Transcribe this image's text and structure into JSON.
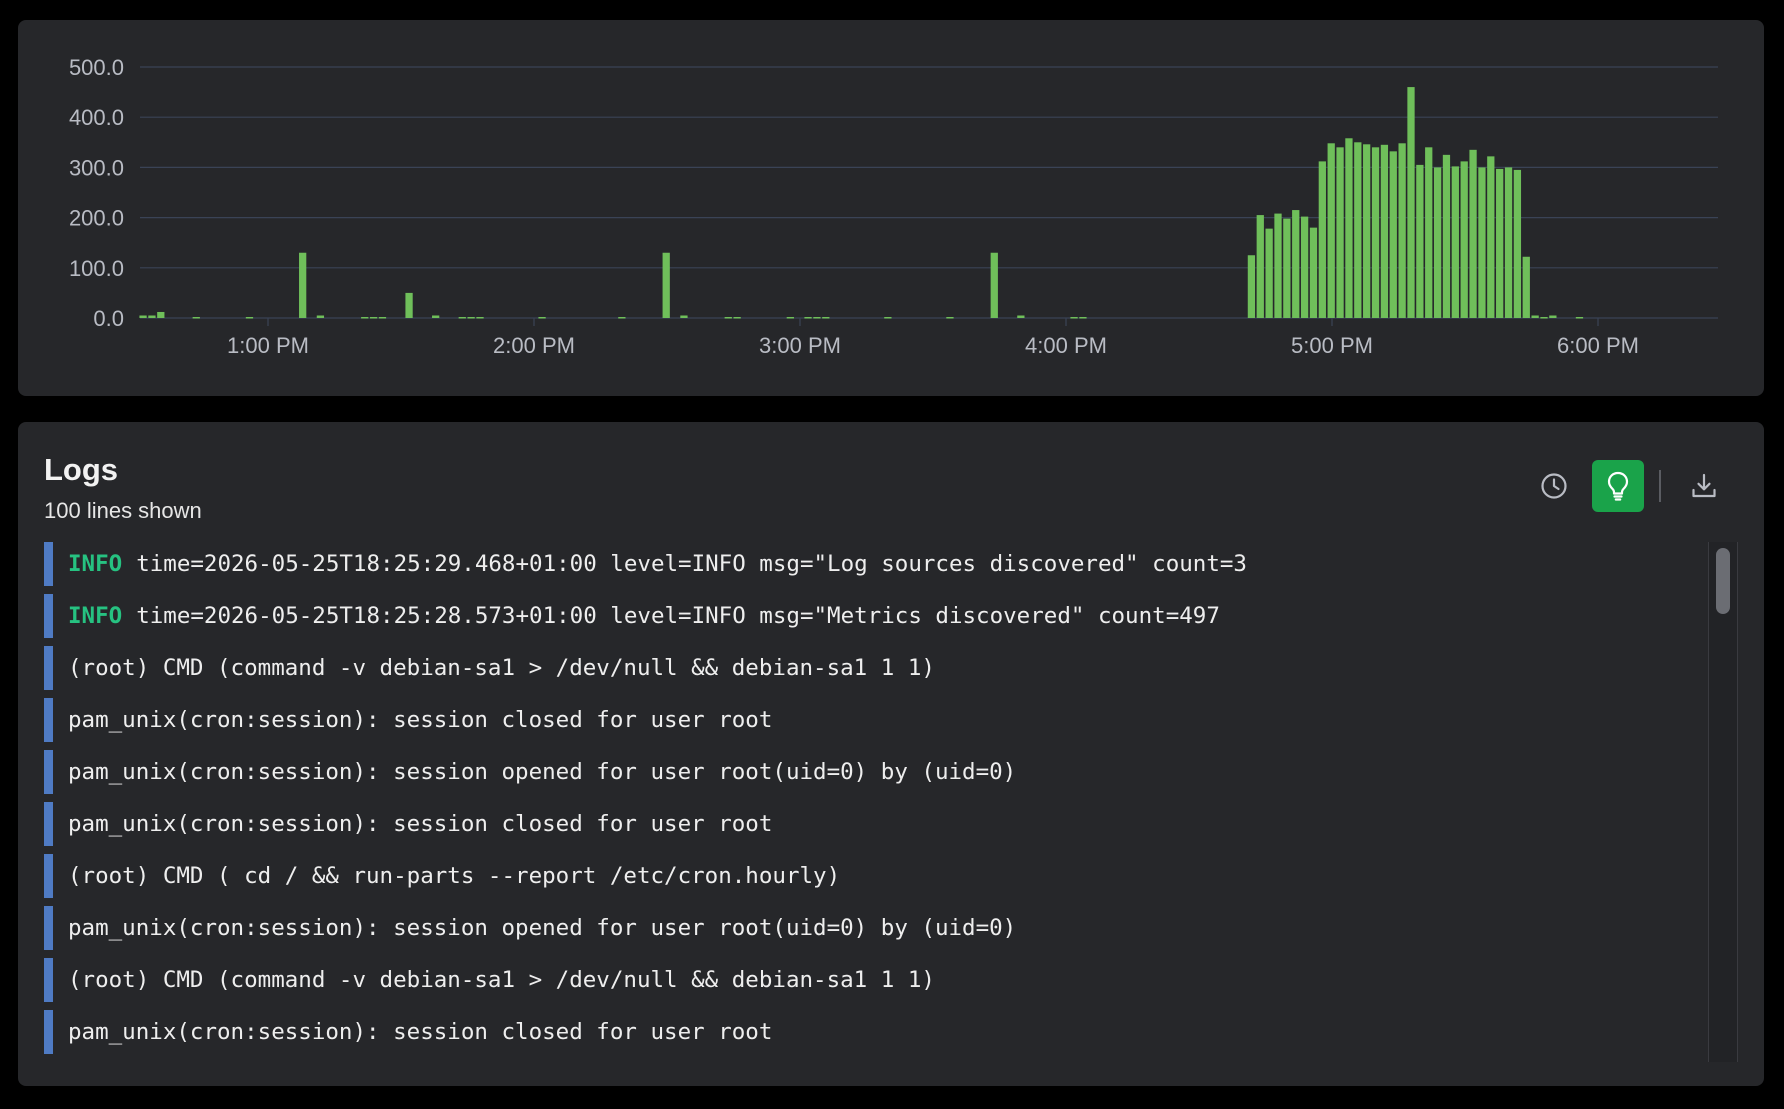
{
  "colors": {
    "bar": "#6fbf5a",
    "accent": "#1aa34a",
    "log_marker": "#4f7bc4",
    "level_info": "#26c281"
  },
  "chart_data": {
    "type": "bar",
    "title": "",
    "xlabel": "",
    "ylabel": "",
    "ylim": [
      0,
      500
    ],
    "y_ticks": [
      "500.0",
      "400.0",
      "300.0",
      "200.0",
      "100.0",
      "0.0"
    ],
    "x_ticks": [
      "1:00 PM",
      "2:00 PM",
      "3:00 PM",
      "4:00 PM",
      "5:00 PM",
      "6:00 PM"
    ],
    "grid": true,
    "x_start": "12:31 PM",
    "bin_minutes": 2,
    "values": [
      5,
      5,
      12,
      0,
      0,
      0,
      2,
      0,
      0,
      0,
      0,
      0,
      2,
      0,
      0,
      0,
      0,
      0,
      130,
      0,
      5,
      0,
      0,
      0,
      0,
      2,
      2,
      2,
      0,
      0,
      50,
      0,
      0,
      5,
      0,
      0,
      2,
      2,
      2,
      0,
      0,
      0,
      0,
      0,
      0,
      2,
      0,
      0,
      0,
      0,
      0,
      0,
      0,
      0,
      2,
      0,
      0,
      0,
      0,
      130,
      0,
      5,
      0,
      0,
      0,
      0,
      2,
      2,
      0,
      0,
      0,
      0,
      0,
      2,
      0,
      2,
      2,
      2,
      0,
      0,
      0,
      0,
      0,
      0,
      2,
      0,
      0,
      0,
      0,
      0,
      0,
      2,
      0,
      0,
      0,
      0,
      130,
      0,
      0,
      5,
      0,
      0,
      0,
      0,
      0,
      2,
      2,
      0,
      0,
      0,
      0,
      0,
      0,
      0,
      0,
      0,
      0,
      0,
      0,
      0,
      0,
      0,
      0,
      0,
      0,
      125,
      205,
      178,
      208,
      198,
      215,
      202,
      180,
      312,
      348,
      340,
      358,
      350,
      346,
      340,
      345,
      332,
      348,
      460,
      305,
      340,
      300,
      325,
      302,
      312,
      335,
      300,
      322,
      297,
      300,
      295,
      122,
      5,
      2,
      5,
      0,
      0,
      2,
      0,
      0,
      0,
      0,
      0,
      0,
      0,
      0,
      0,
      0,
      0,
      0,
      0,
      0,
      0,
      0,
      0,
      0,
      0,
      0,
      0
    ]
  },
  "logs": {
    "title": "Logs",
    "subtitle": "100 lines shown",
    "lines": [
      {
        "level": "INFO",
        "text": "time=2026-05-25T18:25:29.468+01:00 level=INFO msg=\"Log sources discovered\" count=3"
      },
      {
        "level": "INFO",
        "text": "time=2026-05-25T18:25:28.573+01:00 level=INFO msg=\"Metrics discovered\" count=497"
      },
      {
        "level": "",
        "text": "(root) CMD (command -v debian-sa1 > /dev/null && debian-sa1 1 1)"
      },
      {
        "level": "",
        "text": "pam_unix(cron:session): session closed for user root"
      },
      {
        "level": "",
        "text": "pam_unix(cron:session): session opened for user root(uid=0) by (uid=0)"
      },
      {
        "level": "",
        "text": "pam_unix(cron:session): session closed for user root"
      },
      {
        "level": "",
        "text": "(root) CMD ( cd / && run-parts --report /etc/cron.hourly)"
      },
      {
        "level": "",
        "text": "pam_unix(cron:session): session opened for user root(uid=0) by (uid=0)"
      },
      {
        "level": "",
        "text": "(root) CMD (command -v debian-sa1 > /dev/null && debian-sa1 1 1)"
      },
      {
        "level": "",
        "text": "pam_unix(cron:session): session closed for user root"
      }
    ]
  },
  "toolbar": {
    "history_icon": "clock-icon",
    "insights_icon": "lightbulb-icon",
    "download_icon": "download-icon"
  }
}
